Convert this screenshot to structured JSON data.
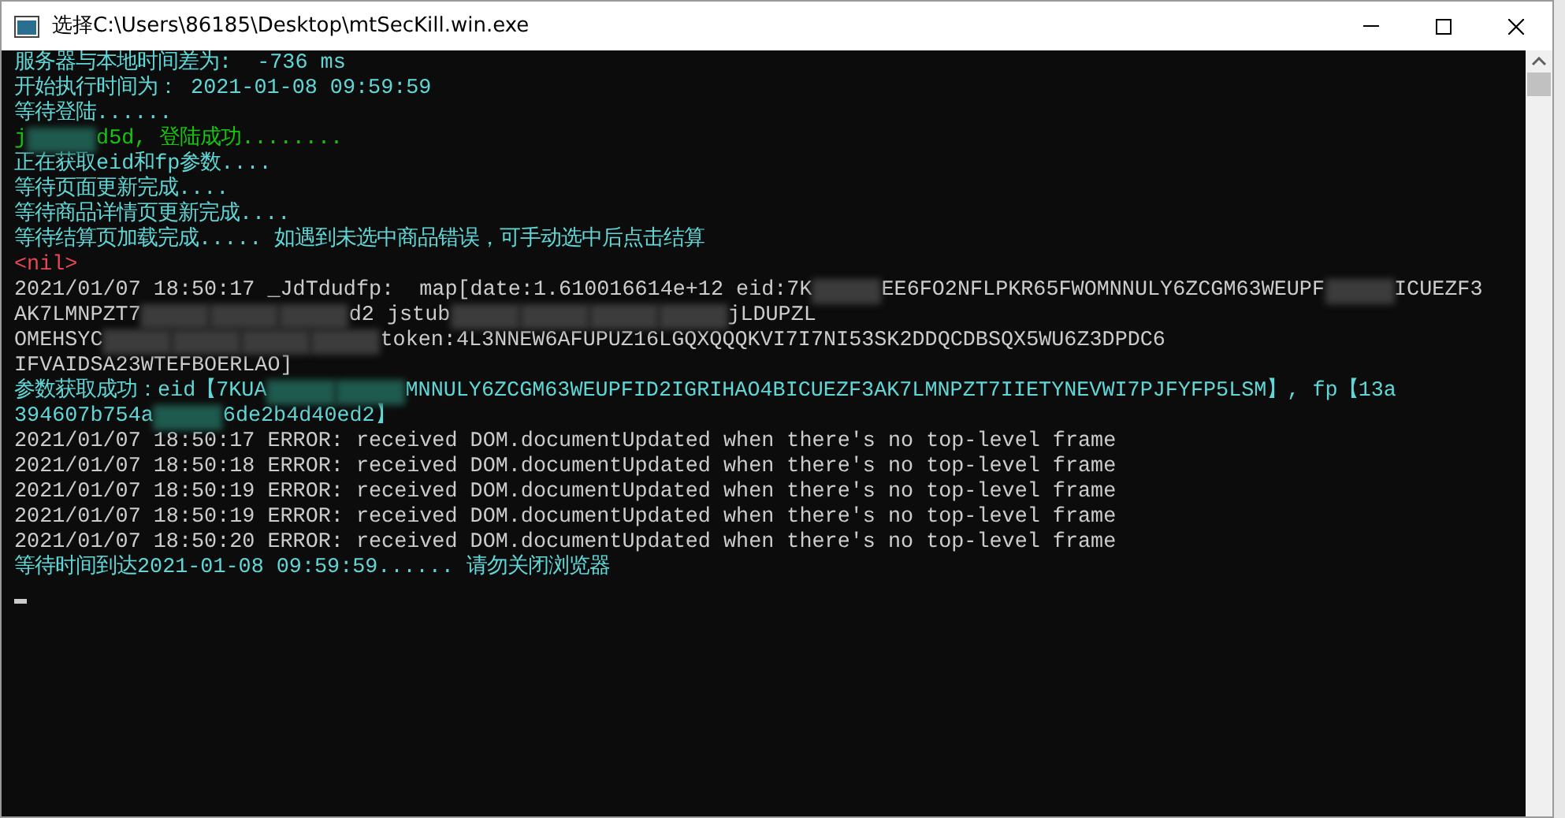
{
  "window": {
    "title": "选择C:\\Users\\86185\\Desktop\\mtSecKill.win.exe"
  },
  "console": {
    "lines": [
      {
        "kind": "info",
        "segments": [
          {
            "kind": "text",
            "text": "服务器与本地时间差为:  -736 ms"
          }
        ]
      },
      {
        "kind": "info",
        "segments": [
          {
            "kind": "text",
            "text": "开始执行时间为： 2021-01-08 09:59:59"
          }
        ]
      },
      {
        "kind": "info",
        "segments": [
          {
            "kind": "text",
            "text": "等待登陆......"
          }
        ]
      },
      {
        "kind": "success",
        "segments": [
          {
            "kind": "text",
            "text": "j"
          },
          {
            "kind": "blur"
          },
          {
            "kind": "text",
            "text": "d5d, 登陆成功........"
          }
        ]
      },
      {
        "kind": "info",
        "segments": [
          {
            "kind": "text",
            "text": "正在获取eid和fp参数...."
          }
        ]
      },
      {
        "kind": "info",
        "segments": [
          {
            "kind": "text",
            "text": "等待页面更新完成...."
          }
        ]
      },
      {
        "kind": "info",
        "segments": [
          {
            "kind": "text",
            "text": "等待商品详情页更新完成...."
          }
        ]
      },
      {
        "kind": "info",
        "segments": [
          {
            "kind": "text",
            "text": "等待结算页加载完成..... 如遇到未选中商品错误，可手动选中后点击结算"
          }
        ]
      },
      {
        "kind": "error",
        "segments": [
          {
            "kind": "text",
            "text": "<nil>"
          }
        ]
      },
      {
        "kind": "plain",
        "segments": [
          {
            "kind": "text",
            "text": "2021/01/07 18:50:17 _JdTdudfp:  map[date:1.610016614e+12 eid:7K"
          },
          {
            "kind": "blur"
          },
          {
            "kind": "text",
            "text": "EE6FO2NFLPKR65FWOMNNULY6ZCGM63WEUPF"
          },
          {
            "kind": "blur"
          },
          {
            "kind": "text",
            "text": "ICUEZF3"
          }
        ]
      },
      {
        "kind": "plain",
        "segments": [
          {
            "kind": "text",
            "text": "AK7LMNPZT7"
          },
          {
            "kind": "blur"
          },
          {
            "kind": "blur"
          },
          {
            "kind": "blur"
          },
          {
            "kind": "text",
            "text": "d2 jstub"
          },
          {
            "kind": "blur"
          },
          {
            "kind": "blur"
          },
          {
            "kind": "blur"
          },
          {
            "kind": "blur"
          },
          {
            "kind": "text",
            "text": "jLDUPZL"
          }
        ]
      },
      {
        "kind": "plain",
        "segments": [
          {
            "kind": "text",
            "text": "OMEHSYC"
          },
          {
            "kind": "blur"
          },
          {
            "kind": "blur"
          },
          {
            "kind": "blur"
          },
          {
            "kind": "blur"
          },
          {
            "kind": "text",
            "text": "token:4L3NNEW6AFUPUZ16LGQXQQQKVI7I7NI53SK2DDQCDBSQX5WU6Z3DPDC6"
          }
        ]
      },
      {
        "kind": "plain",
        "segments": [
          {
            "kind": "text",
            "text": "IFVAIDSA23WTEFBOERLAO]"
          }
        ]
      },
      {
        "kind": "info",
        "segments": [
          {
            "kind": "text",
            "text": "参数获取成功：eid【7KUA"
          },
          {
            "kind": "blur"
          },
          {
            "kind": "blur"
          },
          {
            "kind": "text",
            "text": "MNNULY6ZCGM63WEUPFID2IGRIHAO4BICUEZF3AK7LMNPZT7IIETYNEVWI7PJFYFP5LSM】, fp【13a"
          }
        ]
      },
      {
        "kind": "info",
        "segments": [
          {
            "kind": "text",
            "text": "394607b754a"
          },
          {
            "kind": "blur"
          },
          {
            "kind": "text",
            "text": "6de2b4d40ed2】"
          }
        ]
      },
      {
        "kind": "plain",
        "segments": [
          {
            "kind": "text",
            "text": "2021/01/07 18:50:17 ERROR: received DOM.documentUpdated when there's no top-level frame"
          }
        ]
      },
      {
        "kind": "plain",
        "segments": [
          {
            "kind": "text",
            "text": "2021/01/07 18:50:18 ERROR: received DOM.documentUpdated when there's no top-level frame"
          }
        ]
      },
      {
        "kind": "plain",
        "segments": [
          {
            "kind": "text",
            "text": "2021/01/07 18:50:19 ERROR: received DOM.documentUpdated when there's no top-level frame"
          }
        ]
      },
      {
        "kind": "plain",
        "segments": [
          {
            "kind": "text",
            "text": "2021/01/07 18:50:19 ERROR: received DOM.documentUpdated when there's no top-level frame"
          }
        ]
      },
      {
        "kind": "plain",
        "segments": [
          {
            "kind": "text",
            "text": "2021/01/07 18:50:20 ERROR: received DOM.documentUpdated when there's no top-level frame"
          }
        ]
      },
      {
        "kind": "info",
        "segments": [
          {
            "kind": "text",
            "text": "等待时间到达2021-01-08 09:59:59...... 请勿关闭浏览器"
          }
        ]
      }
    ]
  }
}
